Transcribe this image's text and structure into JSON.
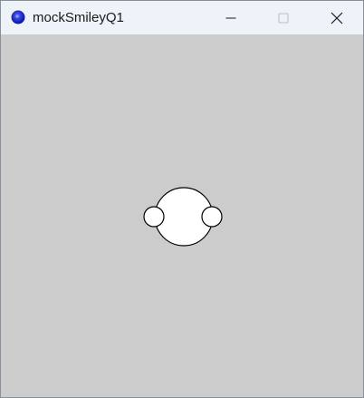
{
  "window": {
    "title": "mockSmileyQ1",
    "app_icon": "processing-app-icon",
    "controls": {
      "minimize_icon": "minimize-icon",
      "maximize_icon": "maximize-icon",
      "close_icon": "close-icon"
    }
  },
  "canvas": {
    "background_color": "#cccccc",
    "face": {
      "fill_color": "#ffffff",
      "stroke_color": "#000000",
      "ears": 2
    }
  }
}
